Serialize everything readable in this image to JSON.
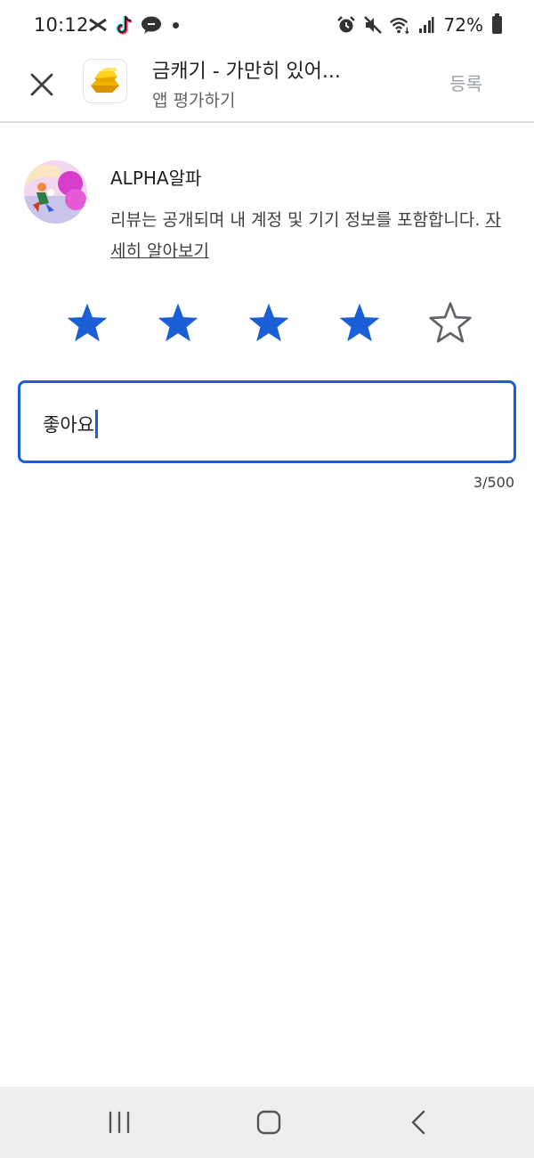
{
  "status_bar": {
    "time": "10:12",
    "battery_percent": "72%",
    "icons_left": [
      "capcut-icon",
      "tiktok-icon",
      "talk-icon",
      "notification-dot"
    ],
    "icons_right": [
      "alarm-icon",
      "mute-icon",
      "wifi-icon",
      "signal-icon",
      "battery-icon"
    ]
  },
  "header": {
    "title": "금캐기 - 가만히 있어...",
    "subtitle": "앱 평가하기",
    "submit_label": "등록",
    "app_icon": "gold-bars-icon"
  },
  "user": {
    "name": "ALPHA알파",
    "notice_text": "리뷰는 공개되며 내 계정 및 기기 정보를 포함합니다. ",
    "learn_more": "자세히 알아보기"
  },
  "rating": {
    "max": 5,
    "value": 4,
    "filled_color": "#1a5fd6",
    "empty_color": "#5f6368"
  },
  "review": {
    "text": "좋아요",
    "char_count": "3/500"
  },
  "colors": {
    "accent": "#1a5fd6",
    "nav_bg": "#eeeeee"
  }
}
